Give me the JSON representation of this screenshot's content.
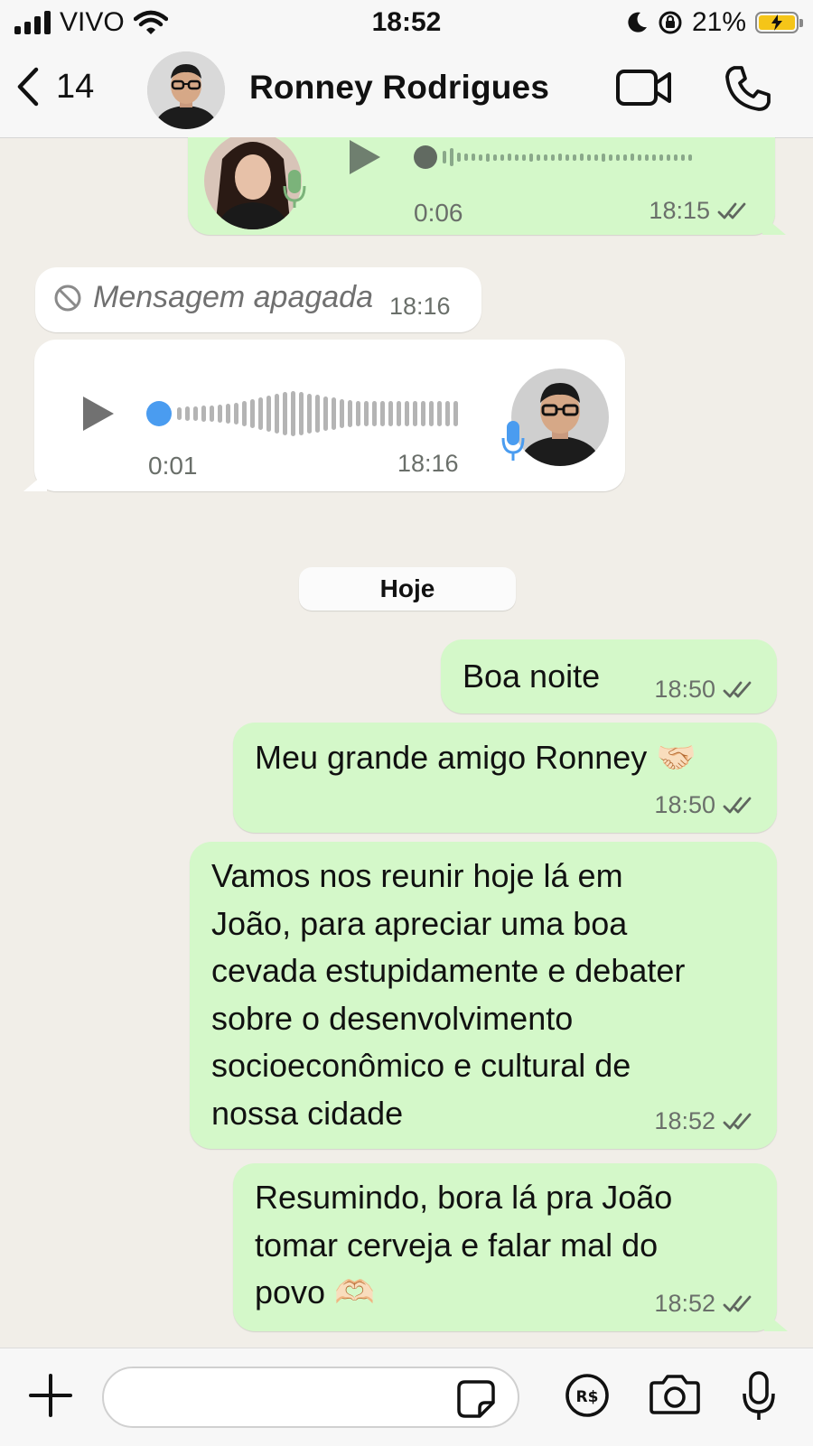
{
  "status_bar": {
    "carrier": "VIVO",
    "time": "18:52",
    "battery": "21%",
    "battery_level": 0.21
  },
  "header": {
    "back_count": "14",
    "contact_name": "Ronney Rodrigues"
  },
  "messages": {
    "voice_out": {
      "duration": "0:06",
      "time": "18:15"
    },
    "deleted": {
      "text": "Mensagem apagada",
      "time": "18:16"
    },
    "voice_in": {
      "duration": "0:01",
      "time": "18:16"
    },
    "date_separator": "Hoje",
    "m1": {
      "text": "Boa noite",
      "time": "18:50"
    },
    "m2": {
      "text": "Meu grande amigo Ronney 🤝🏻",
      "time": "18:50"
    },
    "m3": {
      "lines": [
        "Vamos nos reunir hoje lá em",
        "João, para apreciar uma boa",
        "cevada estupidamente e debater",
        "sobre o desenvolvimento",
        "socioeconômico e cultural de",
        "nossa cidade"
      ],
      "time": "18:52"
    },
    "m4": {
      "lines": [
        "Resumindo, bora lá pra João",
        "tomar cerveja e falar mal do",
        "povo 🫶🏻"
      ],
      "time": "18:52"
    }
  },
  "colors": {
    "outgoing_bubble": "#d4f8c9",
    "incoming_bubble": "#ffffff",
    "background": "#f1eee8",
    "voice_accent": "#4a9cf0"
  },
  "icons": [
    "signal-icon",
    "wifi-icon",
    "moon-icon",
    "orientation-lock-icon",
    "battery-icon",
    "back-chevron-icon",
    "video-call-icon",
    "phone-icon",
    "play-icon",
    "mic-icon",
    "deleted-icon",
    "double-check-icon",
    "plus-icon",
    "sticker-icon",
    "payment-icon",
    "camera-icon",
    "mic-button-icon"
  ]
}
